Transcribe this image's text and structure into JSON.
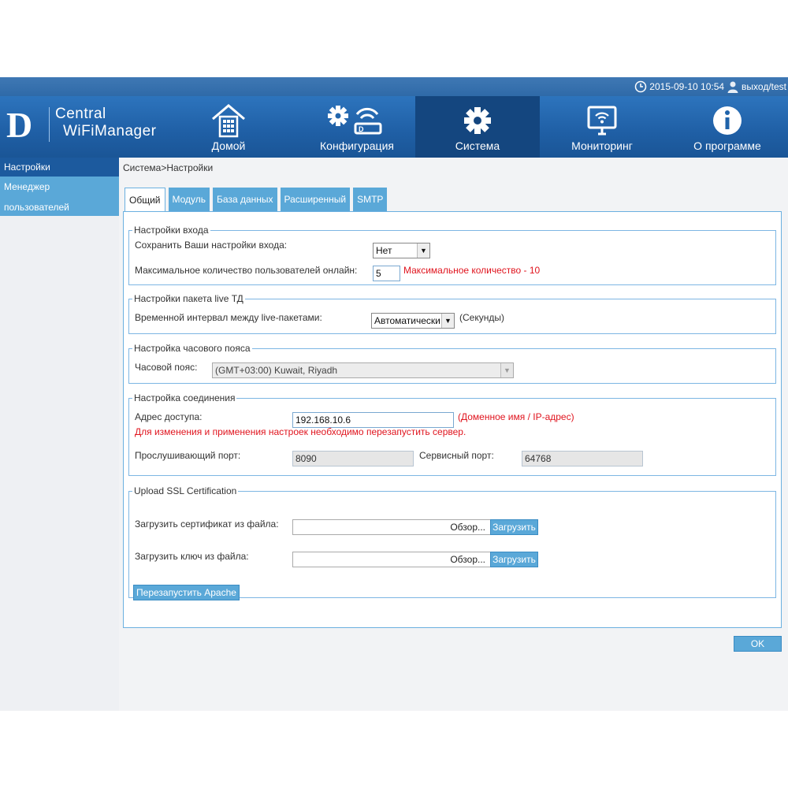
{
  "topbar": {
    "datetime": "2015-09-10 10:54",
    "user": "выход/test"
  },
  "logo": {
    "letter": "D",
    "line1": "Central",
    "line2": "WiFiManager"
  },
  "nav": [
    {
      "label": "Домой",
      "icon": "building-icon"
    },
    {
      "label": "Конфигурация",
      "icon": "gear-router-icon"
    },
    {
      "label": "Система",
      "icon": "gear-icon"
    },
    {
      "label": "Мониторинг",
      "icon": "monitor-wifi-icon"
    },
    {
      "label": "О программе",
      "icon": "info-icon"
    }
  ],
  "sidebar": {
    "items": [
      {
        "label": "Настройки"
      },
      {
        "label1": "Менеджер",
        "label2": "пользователей"
      }
    ]
  },
  "breadcrumb": "Система>Настройки",
  "tabs": [
    "Общий",
    "Модуль",
    "База данных",
    "Расширенный",
    "SMTP"
  ],
  "login": {
    "legend": "Настройки входа",
    "save_label": "Сохранить Ваши настройки входа:",
    "save_value": "Нет",
    "max_label": "Максимальное количество пользователей онлайн:",
    "max_value": "5",
    "max_note": "Максимальное количество - 10"
  },
  "live": {
    "legend": "Настройки пакета live ТД",
    "interval_label": "Временной интервал между live-пакетами:",
    "interval_value": "Автоматически",
    "unit": "(Секунды)"
  },
  "timezone": {
    "legend": "Настройка часового пояса",
    "label": "Часовой пояс:",
    "value": "(GMT+03:00) Kuwait, Riyadh"
  },
  "connection": {
    "legend": "Настройка соединения",
    "address_label": "Адрес доступа:",
    "address_value": "192.168.10.6",
    "address_hint": "(Доменное имя / IP-адрес)",
    "restart_warning": "Для изменения и применения настроек необходимо перезапустить сервер.",
    "listen_label": "Прослушивающий порт:",
    "listen_value": "8090",
    "service_label": "Сервисный порт:",
    "service_value": "64768"
  },
  "ssl": {
    "legend": "Upload SSL Certification",
    "cert_label": "Загрузить сертификат из файла:",
    "key_label": "Загрузить ключ из файла:",
    "browse": "Обзор...",
    "upload": "Загрузить",
    "restart_apache": "Перезапустить Apache"
  },
  "ok": "OK"
}
